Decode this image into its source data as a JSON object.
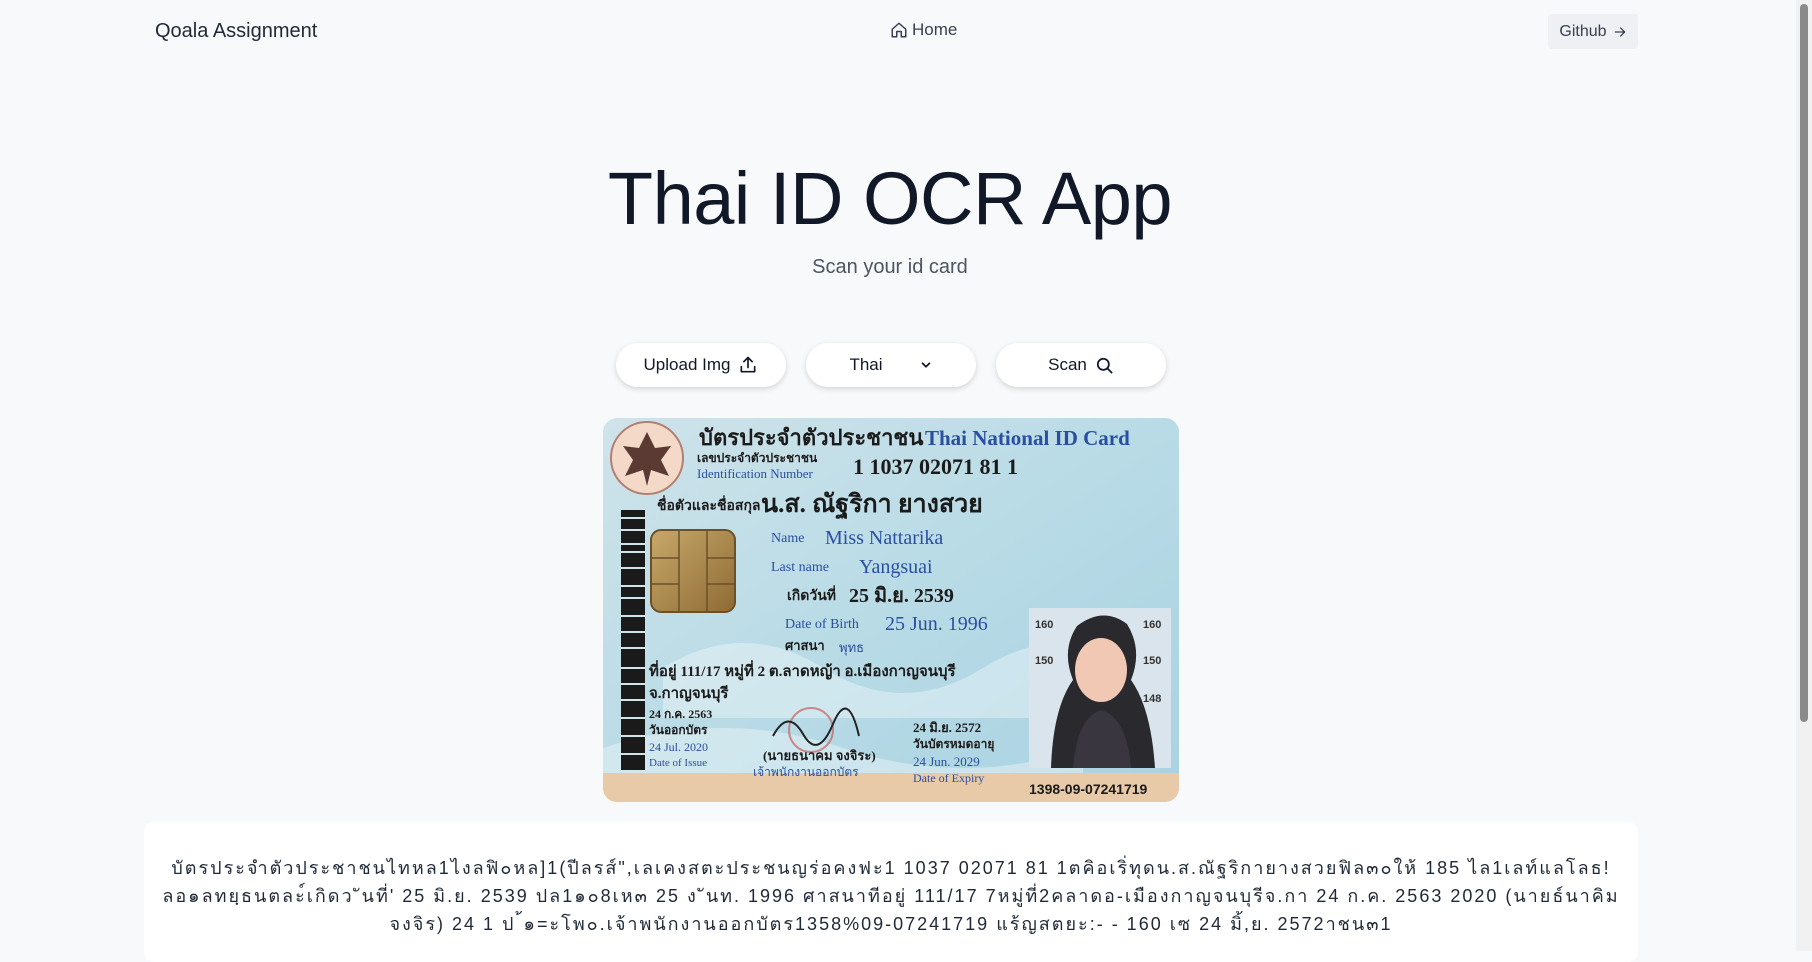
{
  "nav": {
    "brand": "Qoala Assignment",
    "home_label": "Home",
    "github_label": "Github"
  },
  "hero": {
    "title": "Thai ID OCR App",
    "subtitle": "Scan your id card"
  },
  "controls": {
    "upload_label": "Upload Img",
    "language_value": "Thai",
    "scan_label": "Scan"
  },
  "id_card": {
    "title_th": "บัตรประจำตัวประชาชน",
    "title_en": "Thai National ID Card",
    "id_label_th": "เลขประจำตัวประชาชน",
    "id_label_en": "Identification Number",
    "id_number": "1 1037 02071 81 1",
    "name_label_th": "ชื่อตัวและชื่อสกุล",
    "name_th": "น.ส. ณัฐริกา ยางสวย",
    "name_label": "Name",
    "name_en": "Miss Nattarika",
    "last_name_label": "Last name",
    "last_name_en": "Yangsuai",
    "dob_label_th": "เกิดวันที่",
    "dob_th": "25 มิ.ย. 2539",
    "dob_label_en": "Date of Birth",
    "dob_en": "25 Jun. 1996",
    "religion_label": "ศาสนา",
    "religion": "พุทธ",
    "address_line1": "ที่อยู่ 111/17 หมู่ที่ 2 ต.ลาดหญ้า อ.เมืองกาญจนบุรี",
    "address_line2": "จ.กาญจนบุรี",
    "issue_th": "24 ก.ค. 2563",
    "issue_label_th": "วันออกบัตร",
    "issue_en": "24 Jul. 2020",
    "issue_label_en": "Date of Issue",
    "officer": "(นายธนาคม จงจิระ)",
    "officer_title": "เจ้าพนักงานออกบัตร",
    "expiry_th": "24 มิ.ย. 2572",
    "expiry_label_th": "วันบัตรหมดอายุ",
    "expiry_en": "24 Jun. 2029",
    "expiry_label_en": "Date of Expiry",
    "serial": "1398-09-07241719",
    "height_marks": [
      "160",
      "160",
      "150",
      "150",
      "148"
    ]
  },
  "result": {
    "text": "บัตรประจำตัวประชาชนไทหล1ไงลฟิ๐หล]1(ปีลรส์\",เลเคงสตะประชนญร่อคงฟะ1 1037 02071 81 1ตคิอเริ่ทุดน.ส.ณัฐริกายางสวยฟิล๓๐ให้ 185 ไล1เลท์แลโลธ!ลอ๑ลทยฺธนตละ์เกิดว ันที่' 25 มิ.ย. 2539 ปล1๑๐8เห๓ 25 ง ันท. 1996 ศาสนาทีอยู่ 111/17 7หมู่ที่2คลาดอ-เมืองกาญจนบุรีจ.กา 24 ก.ค. 2563 2020 (นายธ์นาคิมจงจิร) 24 1 ป ้๑=ะโพ๐.เจ้าพนักงานออกบัตร1358%09-07241719 แร้ญสตยะ:- - 160 เซ 24 มิ้,ย. 2572าชน๓1"
  },
  "colors": {
    "background": "#f8f9fa",
    "title": "#111827",
    "card_blue": "#2a4fa0"
  }
}
